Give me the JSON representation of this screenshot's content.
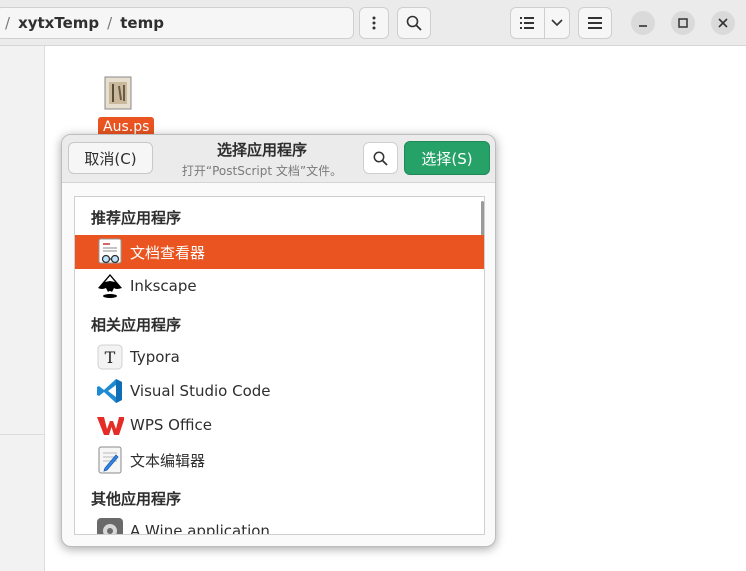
{
  "header": {
    "path": [
      {
        "label": "xytxTemp"
      },
      {
        "label": "temp"
      }
    ]
  },
  "file": {
    "name": "Aus.ps"
  },
  "dialog": {
    "title": "选择应用程序",
    "subtitle": "打开“PostScript 文档”文件。",
    "cancel_label": "取消(C)",
    "select_label": "选择(S)",
    "sections": {
      "recommended": "推荐应用程序",
      "related": "相关应用程序",
      "other": "其他应用程序"
    },
    "apps": [
      {
        "label": "文档查看器",
        "icon": "document-viewer-icon",
        "selected": true
      },
      {
        "label": "Inkscape",
        "icon": "inkscape-icon"
      },
      {
        "label": "Typora",
        "icon": "typora-icon"
      },
      {
        "label": "Visual Studio Code",
        "icon": "vscode-icon"
      },
      {
        "label": "WPS Office",
        "icon": "wps-office-icon"
      },
      {
        "label": "文本编辑器",
        "icon": "text-editor-icon"
      },
      {
        "label": "A Wine application",
        "icon": "wine-icon"
      }
    ]
  },
  "colors": {
    "accent": "#e95420",
    "suggested": "#26a269"
  }
}
